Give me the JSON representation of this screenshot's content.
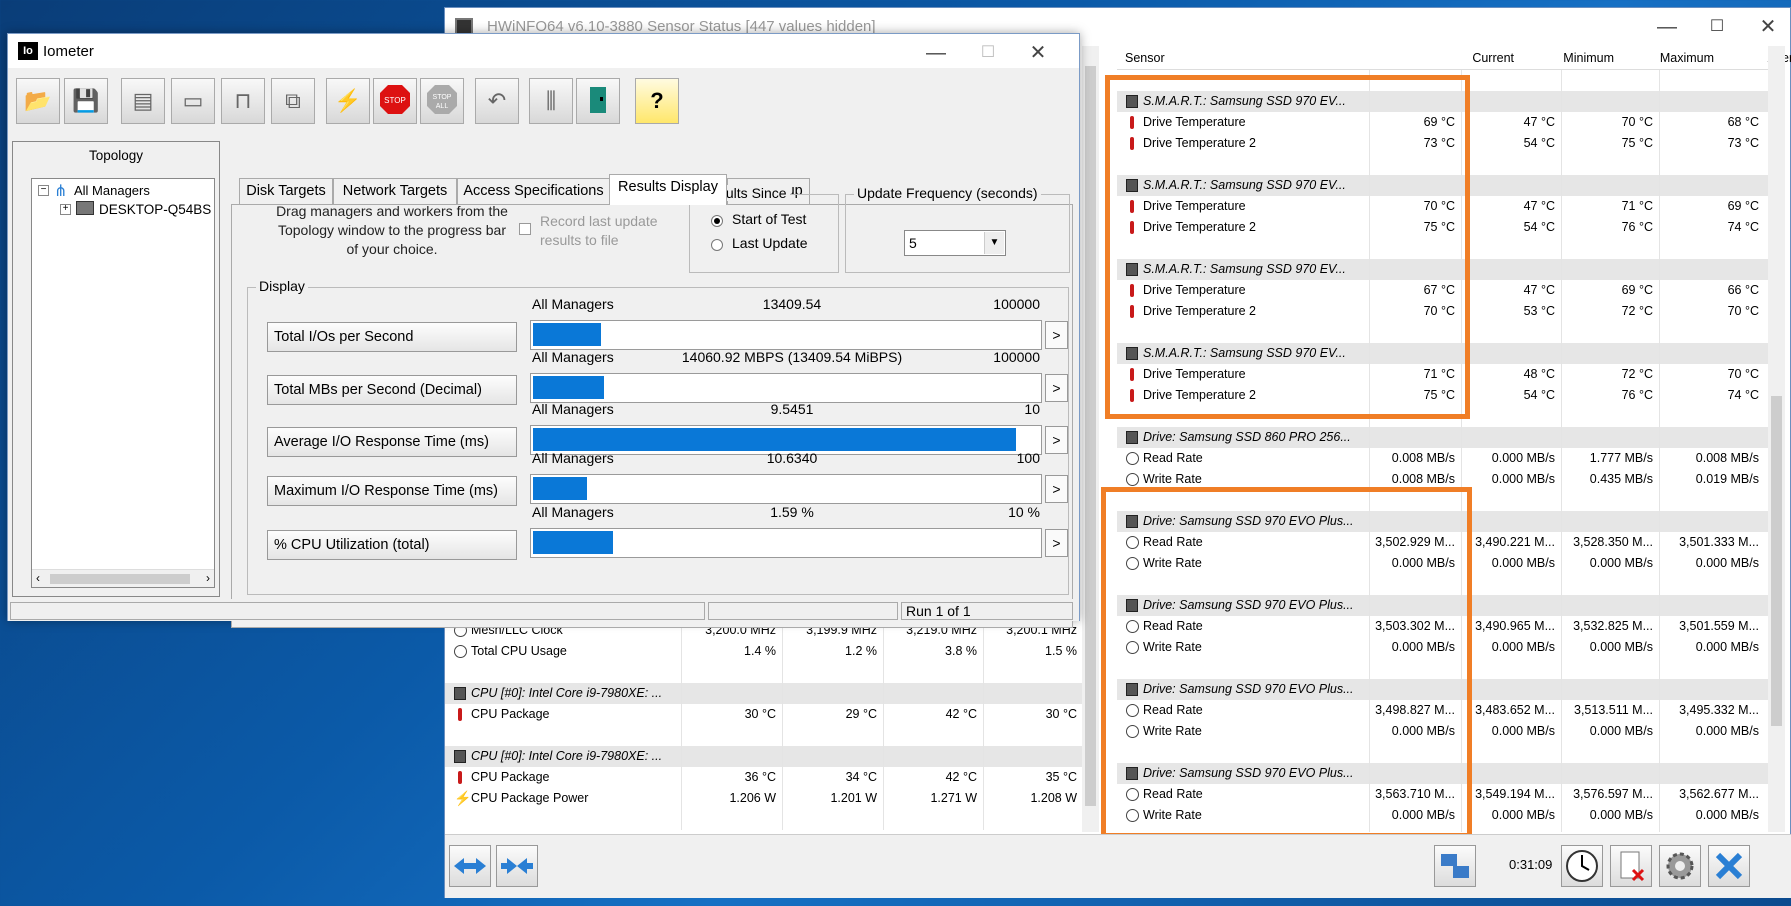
{
  "hwinfo": {
    "title": "HWiNFO64 v6.10-3880 Sensor Status [447 values hidden]",
    "columns": {
      "sensor": "Sensor",
      "current": "Current",
      "minimum": "Minimum",
      "maximum": "Maximum",
      "average": "Average"
    },
    "right_rows": [
      {
        "type": "blank"
      },
      {
        "type": "header",
        "name": "S.M.A.R.T.: Samsung SSD 970 EV..."
      },
      {
        "type": "temp",
        "name": "Drive Temperature",
        "cur": "69 °C",
        "min": "47 °C",
        "max": "70 °C",
        "avg": "68 °C"
      },
      {
        "type": "temp",
        "name": "Drive Temperature 2",
        "cur": "73 °C",
        "min": "54 °C",
        "max": "75 °C",
        "avg": "73 °C"
      },
      {
        "type": "blank"
      },
      {
        "type": "header",
        "name": "S.M.A.R.T.: Samsung SSD 970 EV..."
      },
      {
        "type": "temp",
        "name": "Drive Temperature",
        "cur": "70 °C",
        "min": "47 °C",
        "max": "71 °C",
        "avg": "69 °C"
      },
      {
        "type": "temp",
        "name": "Drive Temperature 2",
        "cur": "75 °C",
        "min": "54 °C",
        "max": "76 °C",
        "avg": "74 °C"
      },
      {
        "type": "blank"
      },
      {
        "type": "header",
        "name": "S.M.A.R.T.: Samsung SSD 970 EV..."
      },
      {
        "type": "temp",
        "name": "Drive Temperature",
        "cur": "67 °C",
        "min": "47 °C",
        "max": "69 °C",
        "avg": "66 °C"
      },
      {
        "type": "temp",
        "name": "Drive Temperature 2",
        "cur": "70 °C",
        "min": "53 °C",
        "max": "72 °C",
        "avg": "70 °C"
      },
      {
        "type": "blank"
      },
      {
        "type": "header",
        "name": "S.M.A.R.T.: Samsung SSD 970 EV..."
      },
      {
        "type": "temp",
        "name": "Drive Temperature",
        "cur": "71 °C",
        "min": "48 °C",
        "max": "72 °C",
        "avg": "70 °C"
      },
      {
        "type": "temp",
        "name": "Drive Temperature 2",
        "cur": "75 °C",
        "min": "54 °C",
        "max": "76 °C",
        "avg": "74 °C"
      },
      {
        "type": "blank"
      },
      {
        "type": "header",
        "name": "Drive: Samsung SSD 860 PRO 256..."
      },
      {
        "type": "rate",
        "name": "Read Rate",
        "cur": "0.008 MB/s",
        "min": "0.000 MB/s",
        "max": "1.777 MB/s",
        "avg": "0.008 MB/s"
      },
      {
        "type": "rate",
        "name": "Write Rate",
        "cur": "0.008 MB/s",
        "min": "0.000 MB/s",
        "max": "0.435 MB/s",
        "avg": "0.019 MB/s"
      },
      {
        "type": "blank"
      },
      {
        "type": "header",
        "name": "Drive: Samsung SSD 970 EVO Plus..."
      },
      {
        "type": "rate",
        "name": "Read Rate",
        "cur": "3,502.929 M...",
        "min": "3,490.221 M...",
        "max": "3,528.350 M...",
        "avg": "3,501.333 M..."
      },
      {
        "type": "rate",
        "name": "Write Rate",
        "cur": "0.000 MB/s",
        "min": "0.000 MB/s",
        "max": "0.000 MB/s",
        "avg": "0.000 MB/s"
      },
      {
        "type": "blank"
      },
      {
        "type": "header",
        "name": "Drive: Samsung SSD 970 EVO Plus..."
      },
      {
        "type": "rate",
        "name": "Read Rate",
        "cur": "3,503.302 M...",
        "min": "3,490.965 M...",
        "max": "3,532.825 M...",
        "avg": "3,501.559 M..."
      },
      {
        "type": "rate",
        "name": "Write Rate",
        "cur": "0.000 MB/s",
        "min": "0.000 MB/s",
        "max": "0.000 MB/s",
        "avg": "0.000 MB/s"
      },
      {
        "type": "blank"
      },
      {
        "type": "header",
        "name": "Drive: Samsung SSD 970 EVO Plus..."
      },
      {
        "type": "rate",
        "name": "Read Rate",
        "cur": "3,498.827 M...",
        "min": "3,483.652 M...",
        "max": "3,513.511 M...",
        "avg": "3,495.332 M..."
      },
      {
        "type": "rate",
        "name": "Write Rate",
        "cur": "0.000 MB/s",
        "min": "0.000 MB/s",
        "max": "0.000 MB/s",
        "avg": "0.000 MB/s"
      },
      {
        "type": "blank"
      },
      {
        "type": "header",
        "name": "Drive: Samsung SSD 970 EVO Plus..."
      },
      {
        "type": "rate",
        "name": "Read Rate",
        "cur": "3,563.710 M...",
        "min": "3,549.194 M...",
        "max": "3,576.597 M...",
        "avg": "3,562.677 M..."
      },
      {
        "type": "rate",
        "name": "Write Rate",
        "cur": "0.000 MB/s",
        "min": "0.000 MB/s",
        "max": "0.000 MB/s",
        "avg": "0.000 MB/s"
      }
    ],
    "left_rows": [
      {
        "type": "clock",
        "name": "Mesh/LLC Clock",
        "cur": "3,200.0 MHz",
        "min": "3,199.9 MHz",
        "max": "3,219.0 MHz",
        "avg": "3,200.1 MHz"
      },
      {
        "type": "clock",
        "name": "Total CPU Usage",
        "cur": "1.4 %",
        "min": "1.2 %",
        "max": "3.8 %",
        "avg": "1.5 %"
      },
      {
        "type": "blank"
      },
      {
        "type": "header",
        "name": "CPU [#0]: Intel Core i9-7980XE: ..."
      },
      {
        "type": "temp",
        "name": "CPU Package",
        "cur": "30 °C",
        "min": "29 °C",
        "max": "42 °C",
        "avg": "30 °C"
      },
      {
        "type": "blank"
      },
      {
        "type": "header",
        "name": "CPU [#0]: Intel Core i9-7980XE: ..."
      },
      {
        "type": "temp",
        "name": "CPU Package",
        "cur": "36 °C",
        "min": "34 °C",
        "max": "42 °C",
        "avg": "35 °C"
      },
      {
        "type": "power",
        "name": "CPU Package Power",
        "cur": "1.206 W",
        "min": "1.201 W",
        "max": "1.271 W",
        "avg": "1.208 W"
      }
    ],
    "timer": "0:31:09"
  },
  "iometer": {
    "title": "Iometer",
    "logo": "Io",
    "toolbar_icons": [
      "open-icon",
      "save-icon",
      "new-manager-icon",
      "new-disk-worker-icon",
      "new-network-worker-icon",
      "copy-worker-icon",
      "start-icon",
      "stop-icon",
      "stop-all-icon",
      "reset-icon",
      "disconnect-icon",
      "exit-icon",
      "about-icon"
    ],
    "topology": {
      "label": "Topology",
      "root": "All Managers",
      "child": "DESKTOP-Q54BS"
    },
    "tabs": [
      "Disk Targets",
      "Network Targets",
      "Access Specifications",
      "Results Display",
      "Test Setup"
    ],
    "drag_hint": "Drag managers and workers from the Topology window to the progress bar of your choice.",
    "record_last": "Record last update results to file",
    "results_since": {
      "label": "Results Since",
      "opt1": "Start of Test",
      "opt2": "Last Update"
    },
    "update_freq": {
      "label": "Update Frequency (seconds)",
      "value": "5"
    },
    "display_label": "Display",
    "metrics": [
      {
        "button": "Total I/Os per Second",
        "scope": "All Managers",
        "value": "13409.54",
        "max": "100000",
        "fraction": 0.134
      },
      {
        "button": "Total MBs per Second (Decimal)",
        "scope": "All Managers",
        "value": "14060.92 MBPS (13409.54 MiBPS)",
        "max": "100000",
        "fraction": 0.14
      },
      {
        "button": "Average I/O Response Time (ms)",
        "scope": "All Managers",
        "value": "9.5451",
        "max": "10",
        "fraction": 0.9545
      },
      {
        "button": "Maximum I/O Response Time (ms)",
        "scope": "All Managers",
        "value": "10.6340",
        "max": "100",
        "fraction": 0.1063
      },
      {
        "button": "% CPU Utilization (total)",
        "scope": "All Managers",
        "value": "1.59 %",
        "max": "10 %",
        "fraction": 0.159
      }
    ],
    "status": "Run 1 of 1"
  },
  "colors": {
    "accent_bar": "#0a78d7",
    "highlight": "#f07e26"
  }
}
